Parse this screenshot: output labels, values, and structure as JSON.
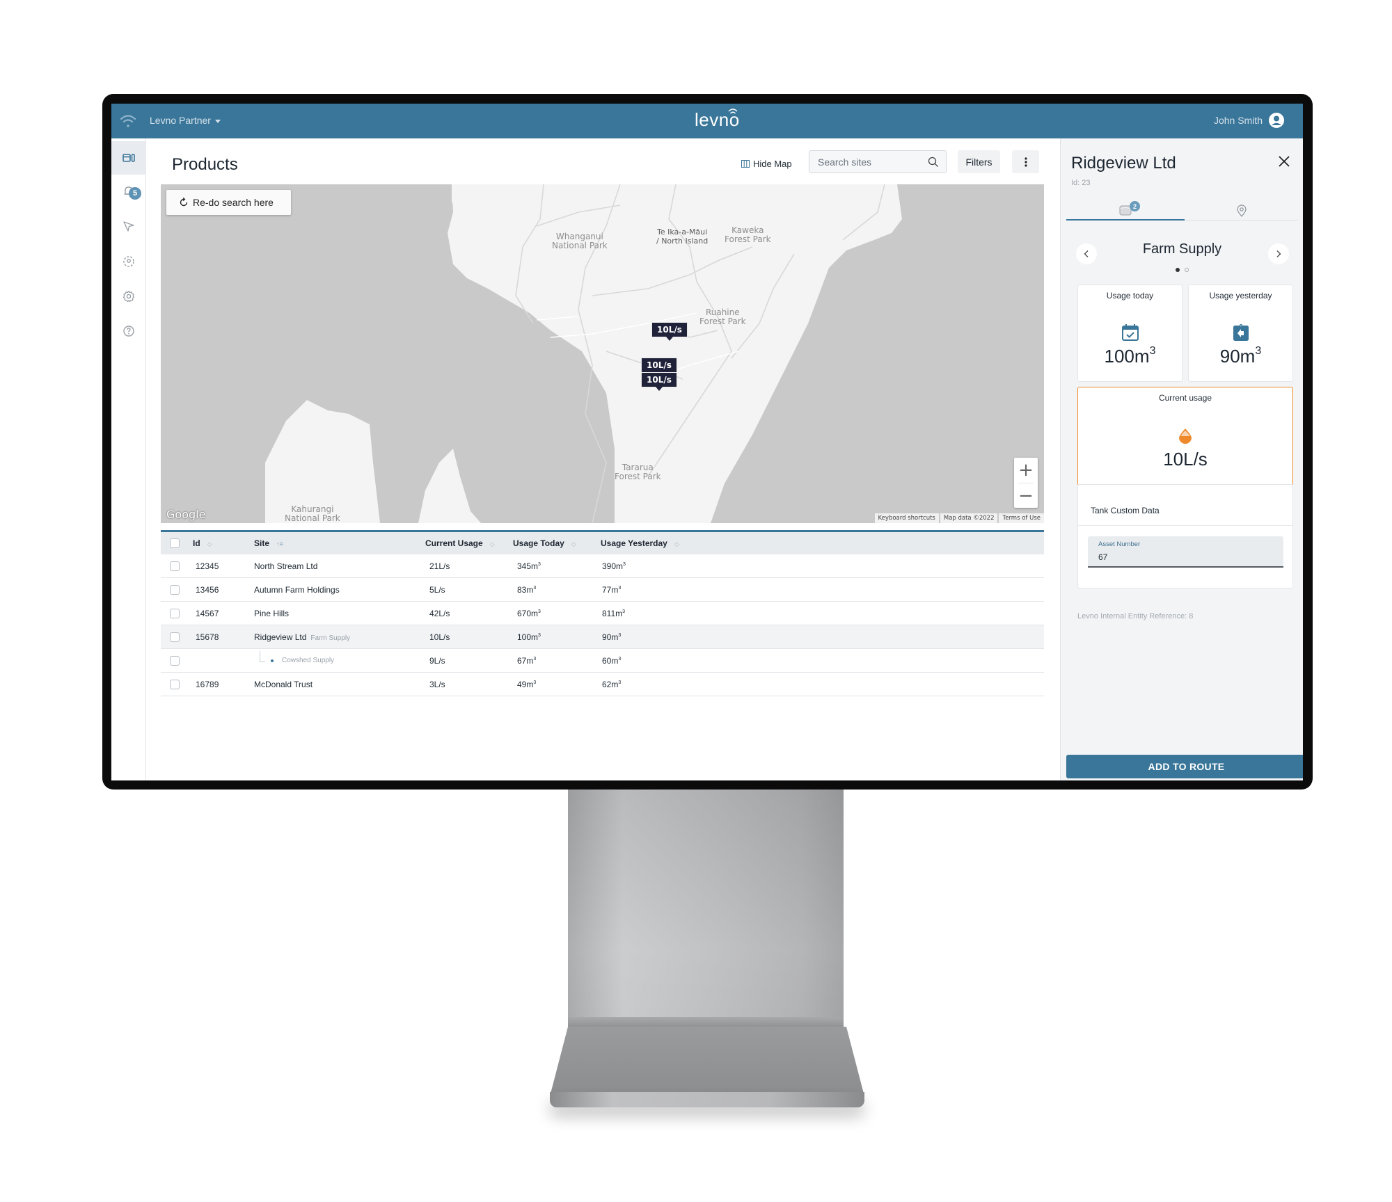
{
  "header": {
    "org_switcher": "Levno Partner",
    "logo": "levno",
    "user_name": "John Smith",
    "icons": {
      "left": "wifi-signal-icon",
      "user": "user-circle-icon"
    }
  },
  "sidebar": {
    "items": [
      {
        "name": "products",
        "icon": "layout-panel-icon",
        "active": true
      },
      {
        "name": "alerts",
        "icon": "bell-icon",
        "badge": "5"
      },
      {
        "name": "routes",
        "icon": "navigation-arrow-icon"
      },
      {
        "name": "locations",
        "icon": "location-target-icon"
      },
      {
        "name": "settings",
        "icon": "gear-icon"
      },
      {
        "name": "help",
        "icon": "help-circle-icon"
      }
    ]
  },
  "main": {
    "title": "Products",
    "toolbar": {
      "hide_map_label": "Hide Map",
      "search_placeholder": "Search sites",
      "filters_label": "Filters"
    },
    "map": {
      "redo_label": "Re-do search here",
      "labels": {
        "whanganui": [
          "Whanganui",
          "National Park"
        ],
        "teika": [
          "Te Ika-a-Māui",
          "/ North Island"
        ],
        "kaweka": [
          "Kaweka",
          "Forest Park"
        ],
        "ruahine": [
          "Ruahine",
          "Forest Park"
        ],
        "tararua": [
          "Tararua",
          "Forest Park"
        ],
        "kahurangi": [
          "Kahurangi",
          "National Park"
        ]
      },
      "markers": [
        "10L/s",
        "10L/s",
        "10L/s"
      ],
      "zoom_in": "+",
      "zoom_out": "−",
      "provider_logo": "Google",
      "attribution": [
        "Keyboard shortcuts",
        "Map data ©2022",
        "Terms of Use"
      ]
    },
    "table": {
      "columns": [
        "Id",
        "Site",
        "Current Usage",
        "Usage Today",
        "Usage Yesterday"
      ],
      "rows": [
        {
          "id": "12345",
          "site": "North Stream Ltd",
          "sub": "",
          "current": "21L/s",
          "today": "345m",
          "yesterday": "390m"
        },
        {
          "id": "13456",
          "site": "Autumn Farm Holdings",
          "sub": "",
          "current": "5L/s",
          "today": "83m",
          "yesterday": "77m"
        },
        {
          "id": "14567",
          "site": "Pine Hills",
          "sub": "",
          "current": "42L/s",
          "today": "670m",
          "yesterday": "811m"
        },
        {
          "id": "15678",
          "site": "Ridgeview Ltd",
          "sub": "Farm Supply",
          "current": "10L/s",
          "today": "100m",
          "yesterday": "90m"
        },
        {
          "id": "",
          "site": "",
          "sub": "Cowshed Supply",
          "current": "9L/s",
          "today": "67m",
          "yesterday": "60m"
        },
        {
          "id": "16789",
          "site": "McDonald Trust",
          "sub": "",
          "current": "3L/s",
          "today": "49m",
          "yesterday": "62m"
        }
      ],
      "unit_superscript": "3"
    }
  },
  "panel": {
    "title": "Ridgeview Ltd",
    "id_label": "Id: 23",
    "tab_badge": "2",
    "carousel_title": "Farm Supply",
    "carousel_page": 1,
    "carousel_pages": 2,
    "usage_today": {
      "label": "Usage today",
      "value": "100m",
      "sup": "3"
    },
    "usage_yesterday": {
      "label": "Usage yesterday",
      "value": "90m",
      "sup": "3"
    },
    "current_usage": {
      "label": "Current usage",
      "value": "10L/s"
    },
    "custom_data": {
      "title": "Tank Custom Data",
      "asset_label": "Asset Number",
      "asset_value": "67"
    },
    "entity_ref": "Levno Internal Entity Reference: 8",
    "add_route_label": "ADD TO ROUTE"
  },
  "colors": {
    "brand": "#3a7699",
    "accent_orange": "#ef8a2c",
    "marker": "#20223a"
  }
}
